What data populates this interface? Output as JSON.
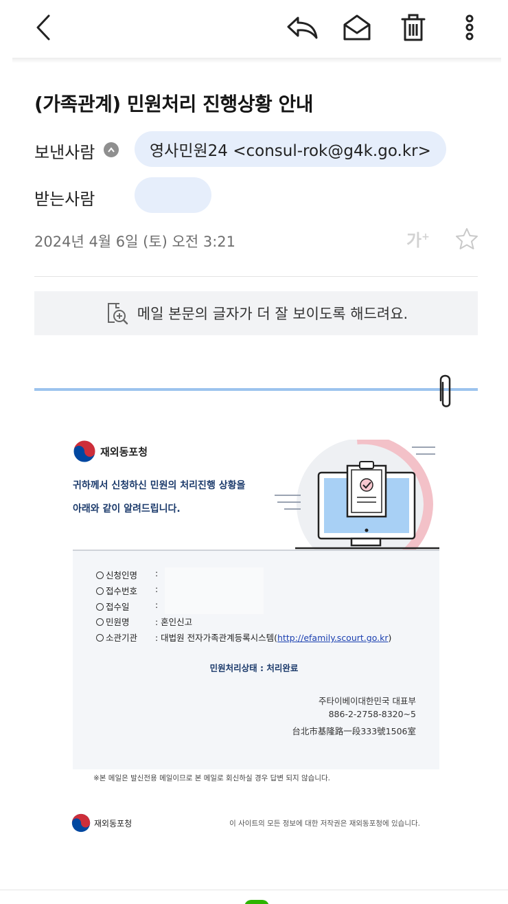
{
  "toolbar": {
    "icons": [
      "back-icon",
      "reply-icon",
      "mark-unread-icon",
      "trash-icon",
      "more-icon"
    ]
  },
  "mail": {
    "subject": "(가족관계) 민원처리 진행상황 안내",
    "sender_label": "보낸사람",
    "sender": "영사민원24 <consul-rok@g4k.go.kr>",
    "recipient_label": "받는사람",
    "recipient": "",
    "date": "2024년 4월 6일 (토) 오전 3:21",
    "font_size_button": "가",
    "font_size_plus": "+",
    "readability_text": "메일 본문의 글자가 더 잘 보이도록 해드려요."
  },
  "body": {
    "brand_name": "재외동포청",
    "lead_line1": "귀하께서 신청하신 민원의 처리진행 상황을",
    "lead_line2": "아래와 같이 알려드립니다.",
    "rows": [
      {
        "label": "신청인명",
        "value": ":"
      },
      {
        "label": "접수번호",
        "value": ":"
      },
      {
        "label": "접수일",
        "value": ":"
      },
      {
        "label": "민원명",
        "value": ": 혼인신고"
      },
      {
        "label": "소관기관",
        "value": ": 대법원 전자가족관계등록시스템(",
        "link": "http://efamily.scourt.go.kr",
        "value_end": ")"
      }
    ],
    "status": "민원처리상태 : 처리완료",
    "sign_line1": "주타이베이대한민국 대표부",
    "sign_line2": "886-2-2758-8320~5",
    "sign_line3": "台北市基隆路一段333號1506室",
    "notice": "※본 메일은 발신전용 메일이므로 본 메일로 회신하실 경우 답변 되지 않습니다.",
    "footer_brand": "재외동포청",
    "footer_copy": "이 사이트의 모든 정보에 대한 저작권은 재외동포청에 있습니다."
  },
  "colors": {
    "chip_bg": "#e6eefb",
    "attach_line": "#9cc3ee",
    "navy": "#1b3a6b",
    "taeguk_red": "#cd2e3a",
    "taeguk_blue": "#0047a0"
  }
}
